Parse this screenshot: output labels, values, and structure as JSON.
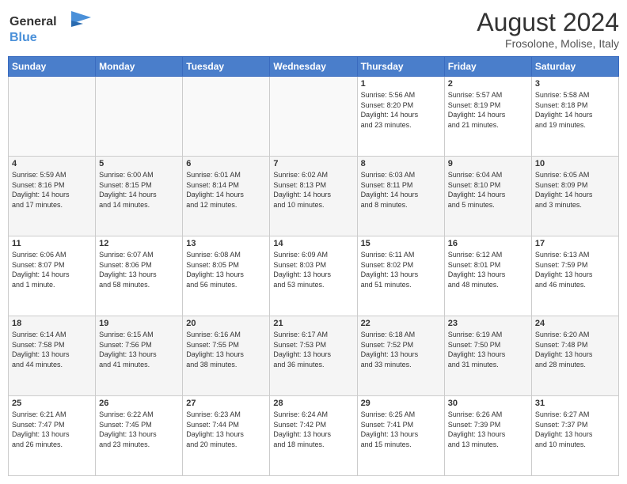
{
  "header": {
    "logo_line1": "General",
    "logo_line2": "Blue",
    "month_year": "August 2024",
    "location": "Frosolone, Molise, Italy"
  },
  "days_of_week": [
    "Sunday",
    "Monday",
    "Tuesday",
    "Wednesday",
    "Thursday",
    "Friday",
    "Saturday"
  ],
  "weeks": [
    [
      {
        "day": "",
        "info": ""
      },
      {
        "day": "",
        "info": ""
      },
      {
        "day": "",
        "info": ""
      },
      {
        "day": "",
        "info": ""
      },
      {
        "day": "1",
        "info": "Sunrise: 5:56 AM\nSunset: 8:20 PM\nDaylight: 14 hours\nand 23 minutes."
      },
      {
        "day": "2",
        "info": "Sunrise: 5:57 AM\nSunset: 8:19 PM\nDaylight: 14 hours\nand 21 minutes."
      },
      {
        "day": "3",
        "info": "Sunrise: 5:58 AM\nSunset: 8:18 PM\nDaylight: 14 hours\nand 19 minutes."
      }
    ],
    [
      {
        "day": "4",
        "info": "Sunrise: 5:59 AM\nSunset: 8:16 PM\nDaylight: 14 hours\nand 17 minutes."
      },
      {
        "day": "5",
        "info": "Sunrise: 6:00 AM\nSunset: 8:15 PM\nDaylight: 14 hours\nand 14 minutes."
      },
      {
        "day": "6",
        "info": "Sunrise: 6:01 AM\nSunset: 8:14 PM\nDaylight: 14 hours\nand 12 minutes."
      },
      {
        "day": "7",
        "info": "Sunrise: 6:02 AM\nSunset: 8:13 PM\nDaylight: 14 hours\nand 10 minutes."
      },
      {
        "day": "8",
        "info": "Sunrise: 6:03 AM\nSunset: 8:11 PM\nDaylight: 14 hours\nand 8 minutes."
      },
      {
        "day": "9",
        "info": "Sunrise: 6:04 AM\nSunset: 8:10 PM\nDaylight: 14 hours\nand 5 minutes."
      },
      {
        "day": "10",
        "info": "Sunrise: 6:05 AM\nSunset: 8:09 PM\nDaylight: 14 hours\nand 3 minutes."
      }
    ],
    [
      {
        "day": "11",
        "info": "Sunrise: 6:06 AM\nSunset: 8:07 PM\nDaylight: 14 hours\nand 1 minute."
      },
      {
        "day": "12",
        "info": "Sunrise: 6:07 AM\nSunset: 8:06 PM\nDaylight: 13 hours\nand 58 minutes."
      },
      {
        "day": "13",
        "info": "Sunrise: 6:08 AM\nSunset: 8:05 PM\nDaylight: 13 hours\nand 56 minutes."
      },
      {
        "day": "14",
        "info": "Sunrise: 6:09 AM\nSunset: 8:03 PM\nDaylight: 13 hours\nand 53 minutes."
      },
      {
        "day": "15",
        "info": "Sunrise: 6:11 AM\nSunset: 8:02 PM\nDaylight: 13 hours\nand 51 minutes."
      },
      {
        "day": "16",
        "info": "Sunrise: 6:12 AM\nSunset: 8:01 PM\nDaylight: 13 hours\nand 48 minutes."
      },
      {
        "day": "17",
        "info": "Sunrise: 6:13 AM\nSunset: 7:59 PM\nDaylight: 13 hours\nand 46 minutes."
      }
    ],
    [
      {
        "day": "18",
        "info": "Sunrise: 6:14 AM\nSunset: 7:58 PM\nDaylight: 13 hours\nand 44 minutes."
      },
      {
        "day": "19",
        "info": "Sunrise: 6:15 AM\nSunset: 7:56 PM\nDaylight: 13 hours\nand 41 minutes."
      },
      {
        "day": "20",
        "info": "Sunrise: 6:16 AM\nSunset: 7:55 PM\nDaylight: 13 hours\nand 38 minutes."
      },
      {
        "day": "21",
        "info": "Sunrise: 6:17 AM\nSunset: 7:53 PM\nDaylight: 13 hours\nand 36 minutes."
      },
      {
        "day": "22",
        "info": "Sunrise: 6:18 AM\nSunset: 7:52 PM\nDaylight: 13 hours\nand 33 minutes."
      },
      {
        "day": "23",
        "info": "Sunrise: 6:19 AM\nSunset: 7:50 PM\nDaylight: 13 hours\nand 31 minutes."
      },
      {
        "day": "24",
        "info": "Sunrise: 6:20 AM\nSunset: 7:48 PM\nDaylight: 13 hours\nand 28 minutes."
      }
    ],
    [
      {
        "day": "25",
        "info": "Sunrise: 6:21 AM\nSunset: 7:47 PM\nDaylight: 13 hours\nand 26 minutes."
      },
      {
        "day": "26",
        "info": "Sunrise: 6:22 AM\nSunset: 7:45 PM\nDaylight: 13 hours\nand 23 minutes."
      },
      {
        "day": "27",
        "info": "Sunrise: 6:23 AM\nSunset: 7:44 PM\nDaylight: 13 hours\nand 20 minutes."
      },
      {
        "day": "28",
        "info": "Sunrise: 6:24 AM\nSunset: 7:42 PM\nDaylight: 13 hours\nand 18 minutes."
      },
      {
        "day": "29",
        "info": "Sunrise: 6:25 AM\nSunset: 7:41 PM\nDaylight: 13 hours\nand 15 minutes."
      },
      {
        "day": "30",
        "info": "Sunrise: 6:26 AM\nSunset: 7:39 PM\nDaylight: 13 hours\nand 13 minutes."
      },
      {
        "day": "31",
        "info": "Sunrise: 6:27 AM\nSunset: 7:37 PM\nDaylight: 13 hours\nand 10 minutes."
      }
    ]
  ],
  "colors": {
    "header_bg": "#4a7ecb",
    "accent_blue": "#4a90d9"
  }
}
